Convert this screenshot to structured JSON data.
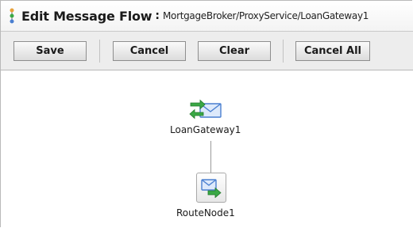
{
  "header": {
    "title": "Edit Message Flow",
    "separator": ":",
    "path": "MortgageBroker/ProxyService/LoanGateway1",
    "icon": "message-flow-icon"
  },
  "toolbar": {
    "save_label": "Save",
    "cancel_label": "Cancel",
    "clear_label": "Clear",
    "cancel_all_label": "Cancel All"
  },
  "flow": {
    "start_node": {
      "label": "LoanGateway1",
      "icon": "proxy-service-icon"
    },
    "route_node": {
      "label": "RouteNode1",
      "icon": "route-node-icon"
    }
  },
  "colors": {
    "toolbar_bg": "#ededed",
    "icon_blue": "#4a7fd0",
    "icon_green": "#3aa845"
  }
}
